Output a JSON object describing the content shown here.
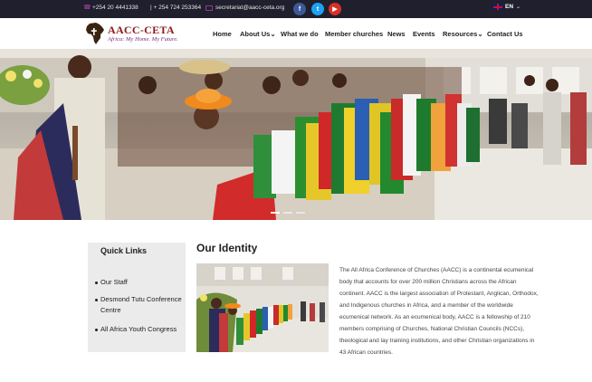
{
  "topbar": {
    "phone1": "+254 20 4441338",
    "phone2": "| + 254 724 253364",
    "email": "secretariat@aacc-ceta.org",
    "social": [
      {
        "icon": "facebook-icon",
        "glyph": "f",
        "color": "#3b5998"
      },
      {
        "icon": "twitter-icon",
        "glyph": "t",
        "color": "#1da1f2"
      },
      {
        "icon": "youtube-icon",
        "glyph": "▶",
        "color": "#d93025"
      }
    ],
    "language": "EN",
    "language_caret": "⌄"
  },
  "logo": {
    "title": "AACC-CETA",
    "tagline": "Africa: My Home. My Future."
  },
  "nav": {
    "items": [
      {
        "label": "Home",
        "dropdown": false
      },
      {
        "label": "About Us",
        "dropdown": true
      },
      {
        "label": "What we do",
        "dropdown": false
      },
      {
        "label": "Member churches",
        "dropdown": false
      },
      {
        "label": "News",
        "dropdown": false
      },
      {
        "label": "Events",
        "dropdown": false
      },
      {
        "label": "Resources",
        "dropdown": true
      },
      {
        "label": "Contact Us",
        "dropdown": false
      }
    ],
    "caret": "⌄"
  },
  "hero": {
    "slide_indicators": 3
  },
  "quick_links": {
    "title": "Quick Links",
    "items": [
      {
        "label": "Our Staff"
      },
      {
        "label": "Desmond Tutu Conference Centre"
      },
      {
        "label": "All Africa Youth Congress"
      }
    ]
  },
  "identity": {
    "title": "Our Identity",
    "body": "The All Africa Conference of Churches (AACC) is a continental ecumenical body that accounts for over 200 million Christians across the African continent. AACC is the largest association of Protestant, Anglican, Orthodox, and Indigenous churches in Africa, and a member of the worldwide ecumenical network. As an ecumenical body, AACC is a fellowship of 210 members comprising of Churches, National Christian Councils (NCCs), theological and lay training institutions, and other Christian organizations in 43 African countries."
  },
  "colors": {
    "topbar_bg": "#1f1f2e",
    "brand_red": "#8b1a1a",
    "brand_purple": "#7a2b80",
    "sidebar_bg": "#ebebeb"
  }
}
